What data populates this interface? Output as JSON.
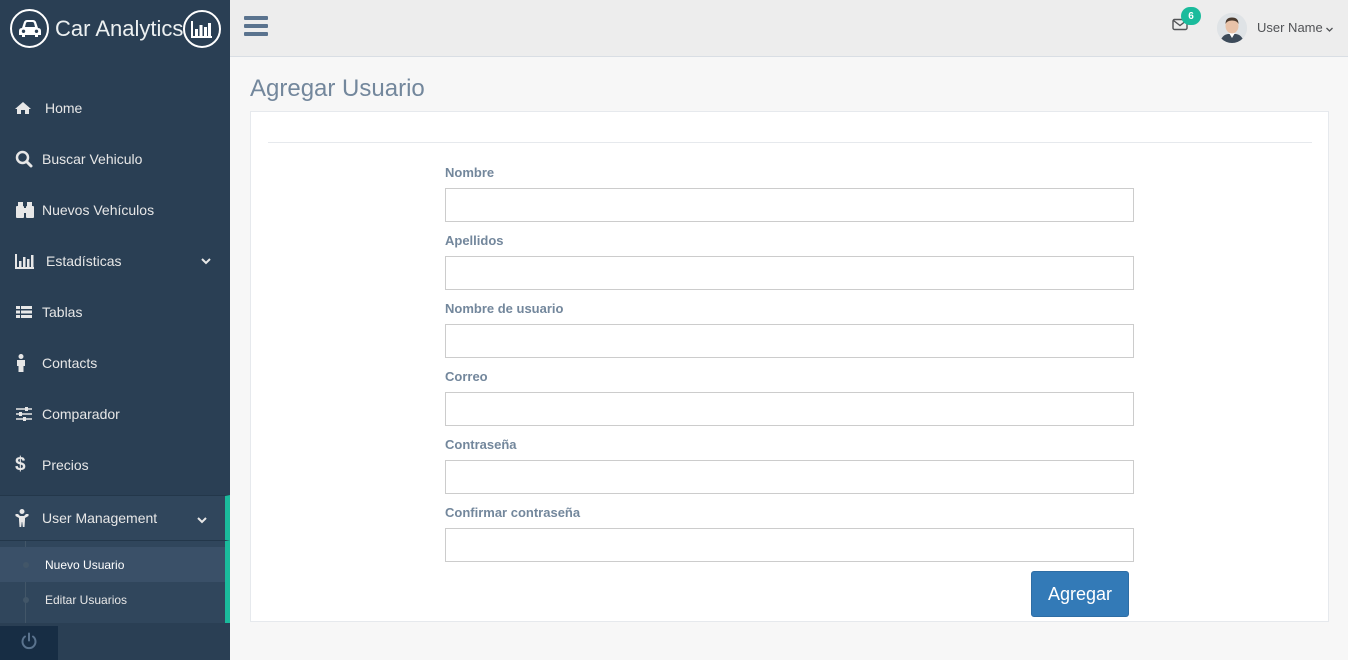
{
  "brand": {
    "title": "Car Analytics",
    "logo_icon": "car-icon",
    "chart_icon": "bar-chart-icon"
  },
  "sidebar": {
    "items": [
      {
        "label": "Home",
        "icon": "home-icon"
      },
      {
        "label": "Buscar Vehiculo",
        "icon": "search-icon"
      },
      {
        "label": "Nuevos Vehículos",
        "icon": "binoculars-icon"
      },
      {
        "label": "Estadísticas",
        "icon": "bar-chart-icon"
      },
      {
        "label": "Tablas",
        "icon": "table-icon"
      },
      {
        "label": "Contacts",
        "icon": "person-icon"
      },
      {
        "label": "Comparador",
        "icon": "sliders-icon"
      },
      {
        "label": "Precios",
        "icon": "dollar-icon"
      },
      {
        "label": "User Management",
        "icon": "child-icon"
      }
    ],
    "submenu": [
      {
        "label": "Nuevo Usuario"
      },
      {
        "label": "Editar Usuarios"
      }
    ]
  },
  "topnav": {
    "notifications": "6",
    "username": "User Name"
  },
  "page": {
    "title": "Agregar Usuario",
    "fields": [
      {
        "label": "Nombre",
        "value": ""
      },
      {
        "label": "Apellidos",
        "value": ""
      },
      {
        "label": "Nombre de usuario",
        "value": ""
      },
      {
        "label": "Correo",
        "value": ""
      },
      {
        "label": "Contraseña",
        "value": ""
      },
      {
        "label": "Confirmar contraseña",
        "value": ""
      }
    ],
    "submit_label": "Agregar"
  },
  "colors": {
    "sidebar": "#2a3f54",
    "accent": "#1abb9c",
    "button": "#337ab7"
  }
}
